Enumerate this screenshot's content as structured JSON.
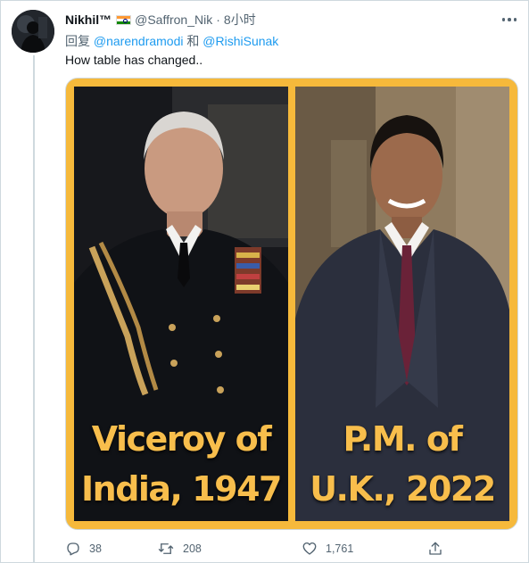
{
  "tweet": {
    "author_name": "Nikhil™",
    "author_flag": "india-flag",
    "author_handle": "@Saffron_Nik",
    "separator": "·",
    "timestamp": "8小时",
    "reply_prefix": "回复",
    "reply_mention_1": "@narendramodi",
    "reply_conjunction": "和",
    "reply_mention_2": "@RishiSunak",
    "text": "How table has changed..",
    "media": {
      "left_caption_line1": "Viceroy of",
      "left_caption_line2": "India, 1947",
      "right_caption_line1": "P.M. of",
      "right_caption_line2": "U.K., 2022",
      "border_color": "#f6b93b",
      "caption_color": "#f8be4c"
    },
    "actions": {
      "reply_icon": "reply-icon",
      "reply_count": "38",
      "retweet_icon": "retweet-icon",
      "retweet_count": "208",
      "like_icon": "heart-icon",
      "like_count": "1,761",
      "share_icon": "share-icon"
    }
  },
  "colors": {
    "text_primary": "#0f1419",
    "text_secondary": "#536471",
    "link": "#1d9bf0",
    "border": "#cfd9de"
  }
}
